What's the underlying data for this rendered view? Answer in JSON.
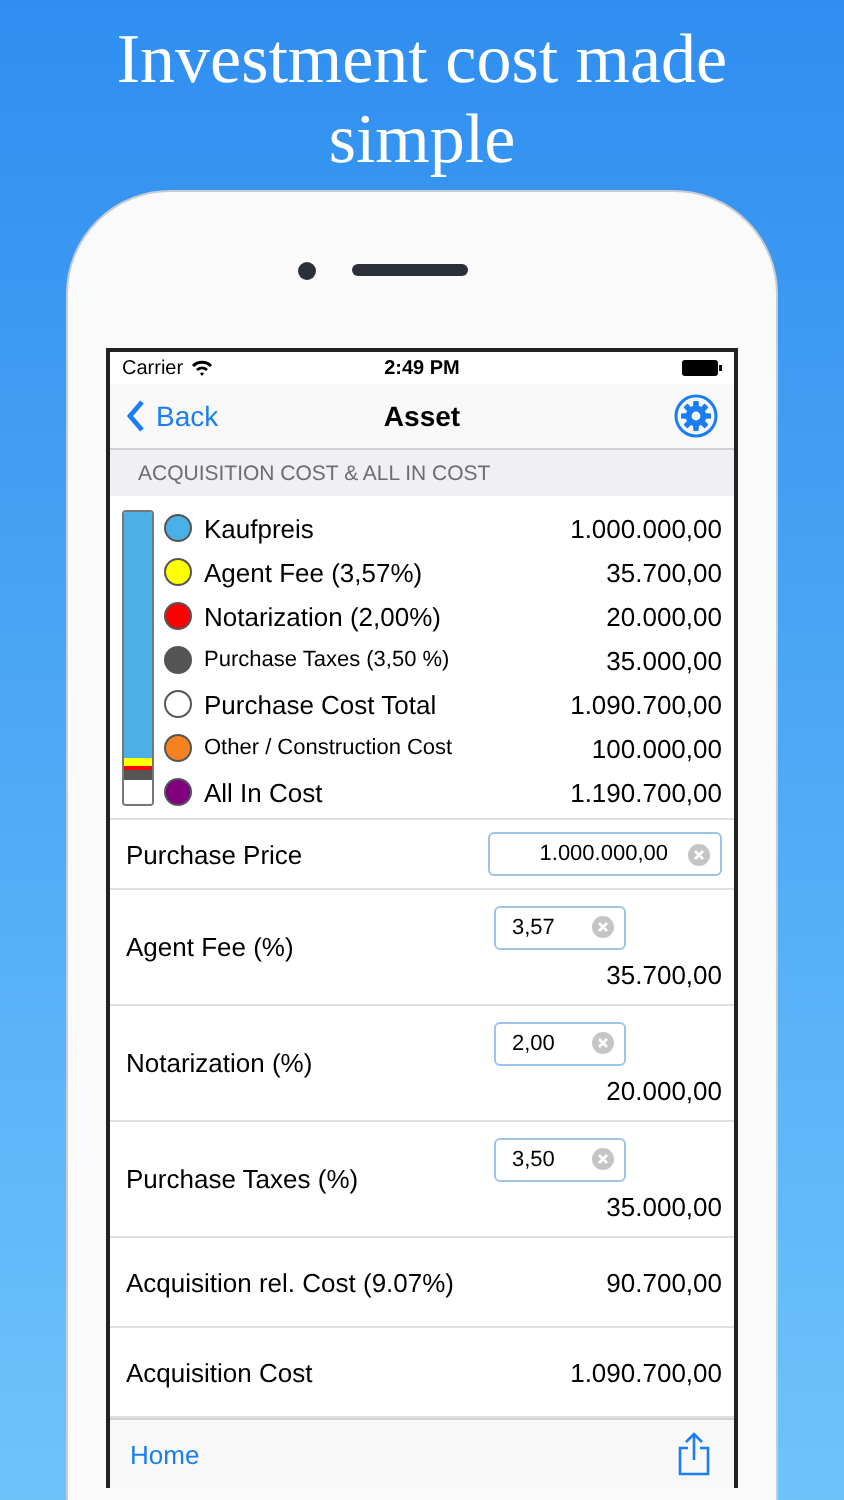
{
  "headline": "Investment cost made simple",
  "status_bar": {
    "carrier": "Carrier",
    "time": "2:49 PM"
  },
  "nav": {
    "back": "Back",
    "title": "Asset"
  },
  "section_header": "ACQUISITION COST & ALL IN COST",
  "legend": [
    {
      "label": "Kaufpreis",
      "value": "1.000.000,00",
      "color": "#4ab0e6",
      "kind": "part",
      "small": false
    },
    {
      "label": "Agent Fee (3,57%)",
      "value": "35.700,00",
      "color": "#ffff00",
      "kind": "part",
      "small": false
    },
    {
      "label": "Notarization (2,00%)",
      "value": "20.000,00",
      "color": "#ff0000",
      "kind": "part",
      "small": false
    },
    {
      "label": "Purchase Taxes (3,50 %)",
      "value": "35.000,00",
      "color": "#555555",
      "kind": "part",
      "small": true
    },
    {
      "label": "Purchase Cost Total",
      "value": "1.090.700,00",
      "color": "#ffffff",
      "kind": "total",
      "small": false
    },
    {
      "label": "Other / Construction Cost",
      "value": "100.000,00",
      "color": "#f58220",
      "kind": "extra",
      "small": true
    },
    {
      "label": "All In Cost",
      "value": "1.190.700,00",
      "color": "#800080",
      "kind": "total",
      "small": false
    }
  ],
  "form": [
    {
      "kind": "input-wide",
      "label": "Purchase Price",
      "input": "1.000.000,00"
    },
    {
      "kind": "input-result",
      "label": "Agent Fee (%)",
      "input": "3,57",
      "result": "35.700,00"
    },
    {
      "kind": "input-result",
      "label": "Notarization (%)",
      "input": "2,00",
      "result": "20.000,00"
    },
    {
      "kind": "input-result",
      "label": "Purchase Taxes (%)",
      "input": "3,50",
      "result": "35.000,00"
    },
    {
      "kind": "value",
      "label": "Acquisition rel. Cost (9.07%)",
      "result": "90.700,00"
    },
    {
      "kind": "value",
      "label": "Acquisition Cost",
      "result": "1.090.700,00"
    }
  ],
  "toolbar": {
    "home": "Home"
  }
}
